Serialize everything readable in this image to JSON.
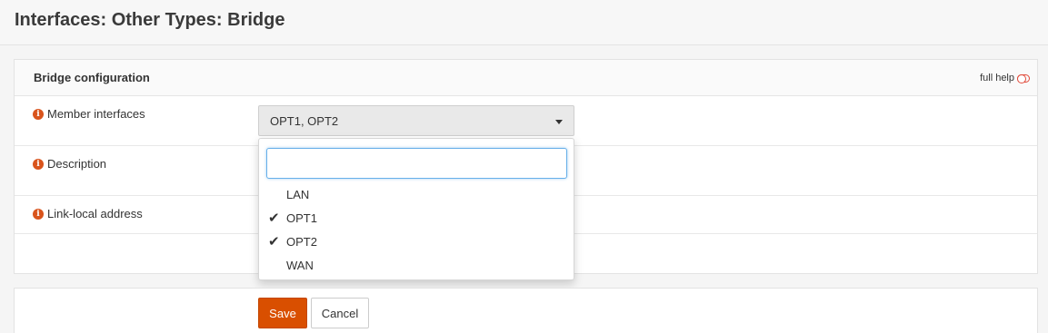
{
  "page": {
    "title": "Interfaces: Other Types: Bridge"
  },
  "panel": {
    "title": "Bridge configuration",
    "full_help": "full help"
  },
  "fields": {
    "member_interfaces": {
      "label": "Member interfaces",
      "value": "OPT1, OPT2"
    },
    "description": {
      "label": "Description"
    },
    "link_local": {
      "label": "Link-local address"
    }
  },
  "dropdown": {
    "search_value": "",
    "options": [
      {
        "label": "LAN",
        "selected": false
      },
      {
        "label": "OPT1",
        "selected": true
      },
      {
        "label": "OPT2",
        "selected": true
      },
      {
        "label": "WAN",
        "selected": false
      }
    ]
  },
  "buttons": {
    "save": "Save",
    "cancel": "Cancel"
  },
  "colors": {
    "accent": "#d94f00",
    "info_icon": "#d9541c",
    "focus": "#66afe9"
  }
}
